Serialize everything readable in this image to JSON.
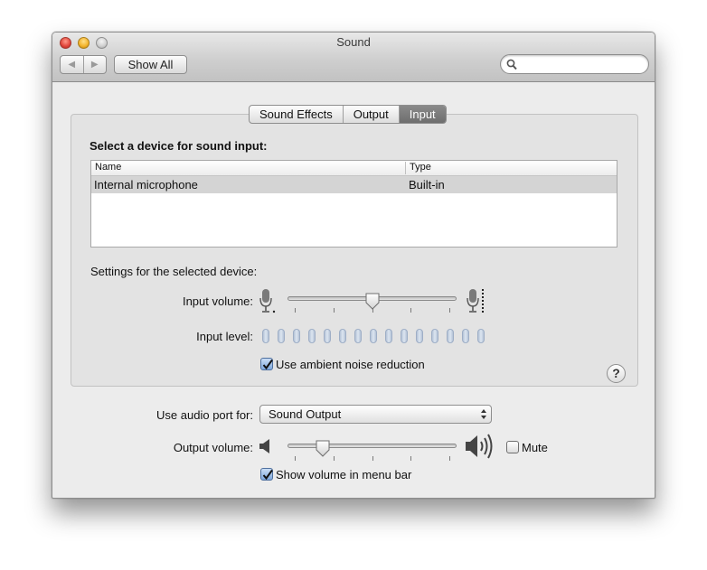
{
  "window": {
    "title": "Sound"
  },
  "toolbar": {
    "back_icon": "back-arrow-icon",
    "forward_icon": "forward-arrow-icon",
    "show_all_label": "Show All",
    "search_placeholder": ""
  },
  "tabs": [
    {
      "label": "Sound Effects",
      "active": false
    },
    {
      "label": "Output",
      "active": false
    },
    {
      "label": "Input",
      "active": true
    }
  ],
  "input_pane": {
    "heading": "Select a device for sound input:",
    "table": {
      "columns": [
        "Name",
        "Type"
      ],
      "rows": [
        {
          "name": "Internal microphone",
          "type": "Built-in",
          "selected": true
        }
      ]
    },
    "settings_label": "Settings for the selected device:",
    "input_volume_label": "Input volume:",
    "input_volume_fraction": 0.5,
    "input_level_label": "Input level:",
    "input_level_segments": 15,
    "input_level_lit": 0,
    "noise_reduction_label": "Use ambient noise reduction",
    "noise_reduction_checked": true,
    "help_label": "?"
  },
  "bottom": {
    "audio_port_label": "Use audio port for:",
    "audio_port_value": "Sound Output",
    "output_volume_label": "Output volume:",
    "output_volume_fraction": 0.21,
    "mute_label": "Mute",
    "mute_checked": false,
    "show_volume_label": "Show volume in menu bar",
    "show_volume_checked": true
  },
  "colors": {
    "selected_row": "#d4d4d4",
    "active_tab": "#7a7a7a",
    "level_pill": "#c9d5e5"
  }
}
